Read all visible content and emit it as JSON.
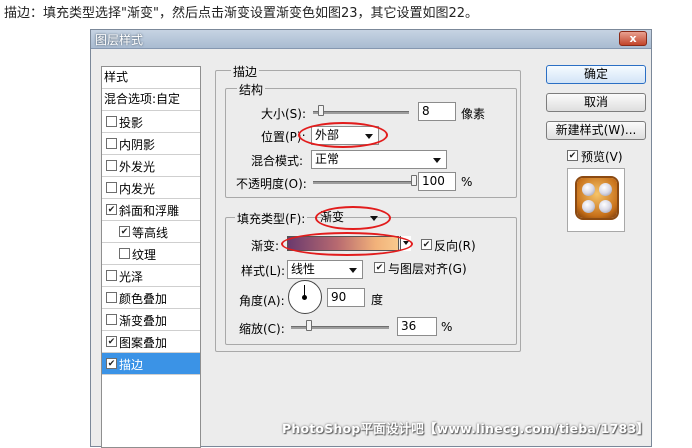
{
  "caption": "描边：填充类型选择\"渐变\"，然后点击渐变设置渐变色如图23，其它设置如图22。",
  "dialog": {
    "title": "图层样式",
    "close_label": "x"
  },
  "style_list": {
    "header": "样式",
    "blend_options": "混合选项:自定",
    "items": [
      {
        "label": "投影",
        "checked": false
      },
      {
        "label": "内阴影",
        "checked": false
      },
      {
        "label": "外发光",
        "checked": false
      },
      {
        "label": "内发光",
        "checked": false
      },
      {
        "label": "斜面和浮雕",
        "checked": true
      },
      {
        "label": "等高线",
        "checked": true,
        "indent": true
      },
      {
        "label": "纹理",
        "checked": false,
        "indent": true
      },
      {
        "label": "光泽",
        "checked": false
      },
      {
        "label": "颜色叠加",
        "checked": false
      },
      {
        "label": "渐变叠加",
        "checked": false
      },
      {
        "label": "图案叠加",
        "checked": true
      },
      {
        "label": "描边",
        "checked": true,
        "selected": true
      }
    ]
  },
  "stroke": {
    "group_title": "描边",
    "structure_title": "结构",
    "size_label": "大小(S):",
    "size_value": "8",
    "size_unit": "像素",
    "size_level": 0.05,
    "position_label": "位置(P):",
    "position_value": "外部",
    "blend_mode_label": "混合模式:",
    "blend_mode_value": "正常",
    "opacity_label": "不透明度(O):",
    "opacity_value": "100",
    "opacity_unit": "%",
    "opacity_level": 1.0
  },
  "fill": {
    "fill_type_label": "填充类型(F):",
    "fill_type_value": "渐变",
    "gradient_label": "渐变:",
    "reverse_label": "反向(R)",
    "reverse_checked": true,
    "style_label": "样式(L):",
    "style_value": "线性",
    "align_label": "与图层对齐(G)",
    "align_checked": true,
    "angle_label": "角度(A):",
    "angle_value": "90",
    "angle_unit": "度",
    "scale_label": "缩放(C):",
    "scale_value": "36",
    "scale_unit": "%",
    "scale_level": 0.16
  },
  "buttons": {
    "ok": "确定",
    "cancel": "取消",
    "new_style": "新建样式(W)...",
    "preview_label": "预览(V)",
    "preview_checked": true
  },
  "watermark": "PhotoShop平面设计吧【www.linecg.com/tieba/1783】",
  "colors": {
    "highlight": "#e21c1c",
    "selection": "#3b93e6",
    "gradient_start": "#6a3a6e",
    "gradient_end": "#f8c98d"
  }
}
